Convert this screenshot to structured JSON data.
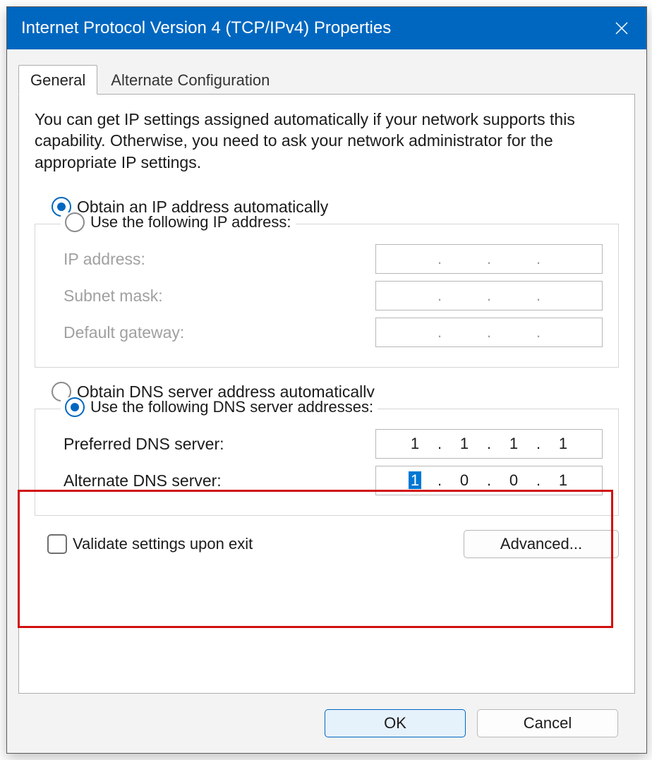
{
  "window": {
    "title": "Internet Protocol Version 4 (TCP/IPv4) Properties"
  },
  "tabs": {
    "general": "General",
    "alternate": "Alternate Configuration"
  },
  "description": "You can get IP settings assigned automatically if your network supports this capability. Otherwise, you need to ask your network administrator for the appropriate IP settings.",
  "ip": {
    "auto_label": "Obtain an IP address automatically",
    "manual_label": "Use the following IP address:",
    "selected": "auto",
    "fields": {
      "ip_address_label": "IP address:",
      "subnet_label": "Subnet mask:",
      "gateway_label": "Default gateway:",
      "ip_address": [
        "",
        "",
        "",
        ""
      ],
      "subnet": [
        "",
        "",
        "",
        ""
      ],
      "gateway": [
        "",
        "",
        "",
        ""
      ]
    }
  },
  "dns": {
    "auto_label": "Obtain DNS server address automatically",
    "manual_label": "Use the following DNS server addresses:",
    "selected": "manual",
    "preferred_label": "Preferred DNS server:",
    "alternate_label": "Alternate DNS server:",
    "preferred": [
      "1",
      "1",
      "1",
      "1"
    ],
    "alternate": [
      "1",
      "0",
      "0",
      "1"
    ],
    "alternate_selected_octet_index": 0
  },
  "validate": {
    "label": "Validate settings upon exit",
    "checked": false
  },
  "buttons": {
    "advanced": "Advanced...",
    "ok": "OK",
    "cancel": "Cancel"
  },
  "dot": "."
}
